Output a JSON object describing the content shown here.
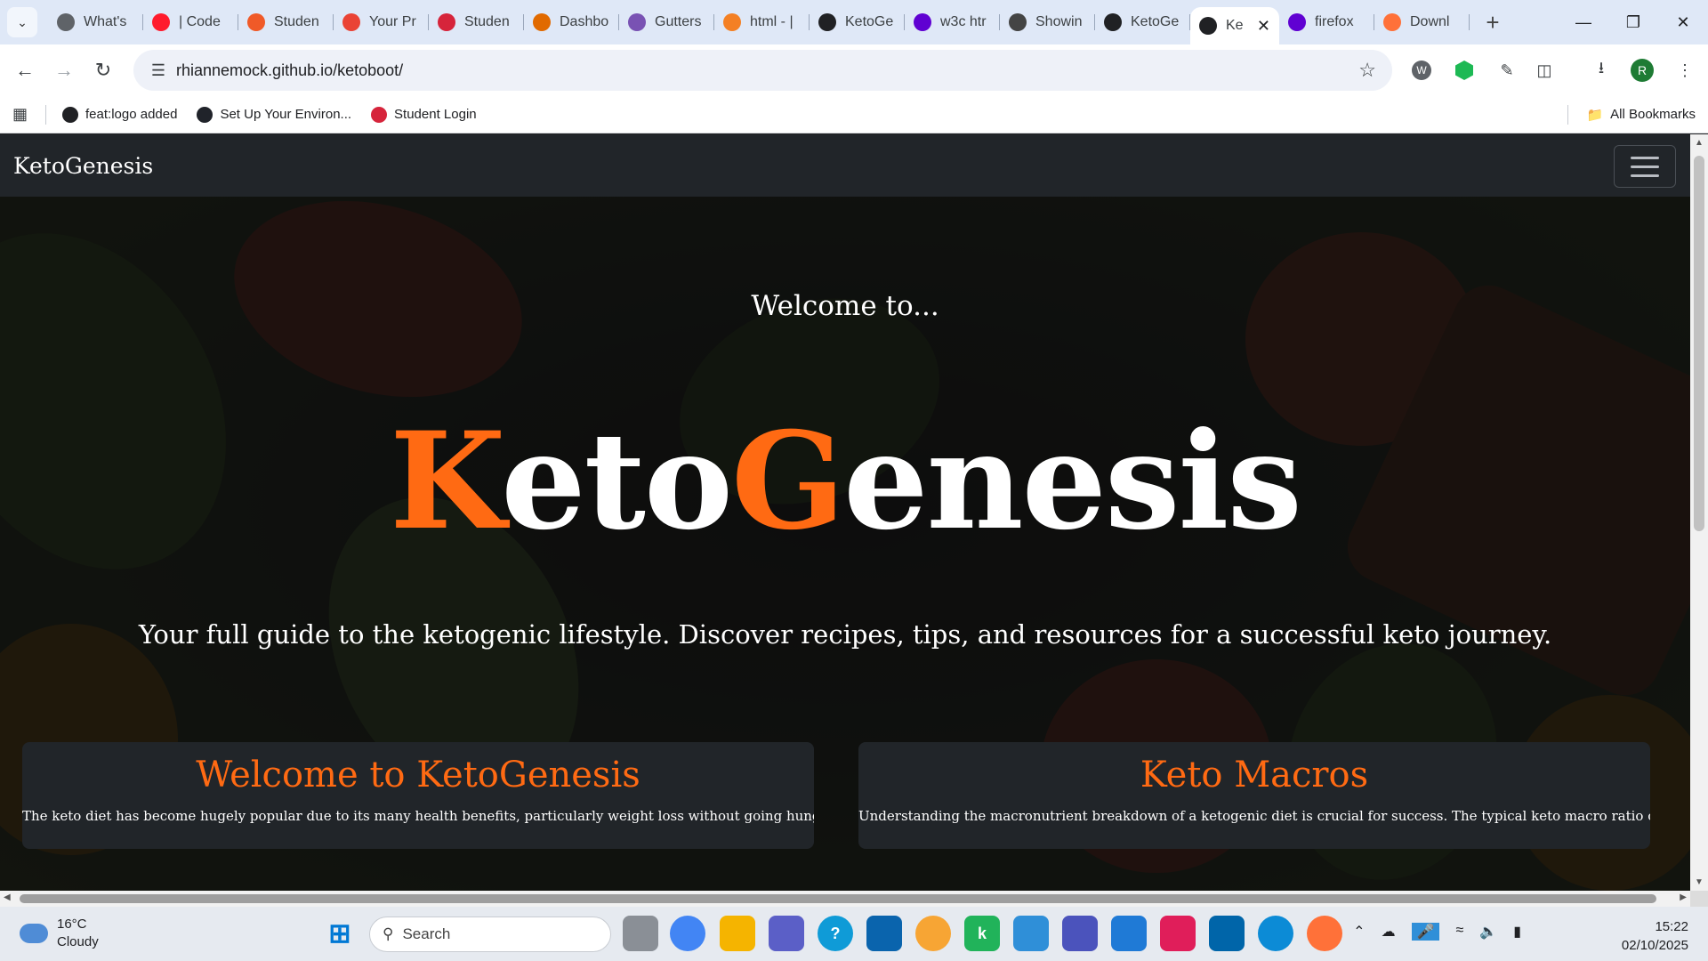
{
  "browser": {
    "tabs": [
      {
        "label": "What's",
        "icon": "chrome-icon",
        "color": "#5f6368"
      },
      {
        "label": "| Code",
        "icon": "opera-icon",
        "color": "#ff1b2d"
      },
      {
        "label": "Studen",
        "icon": "swirl-icon",
        "color": "#f05a28"
      },
      {
        "label": "Your Pr",
        "icon": "gmail-icon",
        "color": "#ea4335"
      },
      {
        "label": "Studen",
        "icon": "school-icon",
        "color": "#d6243b"
      },
      {
        "label": "Dashbo",
        "icon": "dashboard-icon",
        "color": "#e16a00"
      },
      {
        "label": "Gutters",
        "icon": "bootstrap-icon",
        "color": "#7952b3"
      },
      {
        "label": "html - |",
        "icon": "stackoverflow-icon",
        "color": "#f48024"
      },
      {
        "label": "KetoGe",
        "icon": "kg-icon",
        "color": "#202124"
      },
      {
        "label": "w3c htr",
        "icon": "yahoo-icon",
        "color": "#6001d2"
      },
      {
        "label": "Showin",
        "icon": "github-icon",
        "color": "#444444"
      },
      {
        "label": "KetoGe",
        "icon": "kg-icon",
        "color": "#202124"
      },
      {
        "label": "Ke",
        "icon": "kg-icon",
        "color": "#202124",
        "active": true
      },
      {
        "label": "firefox",
        "icon": "yahoo-icon",
        "color": "#6001d2"
      },
      {
        "label": "Downl",
        "icon": "firefox-icon",
        "color": "#ff7139"
      }
    ],
    "url": "rhiannemock.github.io/ketoboot/",
    "profile_initial": "R",
    "bookmarks": [
      {
        "label": "feat:logo added",
        "icon": "github-icon"
      },
      {
        "label": "Set Up Your Environ...",
        "icon": "react-icon"
      },
      {
        "label": "Student Login",
        "icon": "school-icon"
      }
    ],
    "all_bookmarks": "All Bookmarks"
  },
  "page": {
    "brand": "KetoGenesis",
    "hero": {
      "welcome": "Welcome to...",
      "title_k": "K",
      "title_eto": "eto",
      "title_g": "G",
      "title_enesis": "enesis",
      "tagline": "Your full guide to the ketogenic lifestyle. Discover recipes, tips, and resources for a successful keto journey."
    },
    "cards": [
      {
        "title": "Welcome to KetoGenesis",
        "text": "The keto diet has become hugely popular due to its many health benefits, particularly weight loss without going hungry."
      },
      {
        "title": "Keto Macros",
        "text": "Understanding the macronutrient breakdown of a ketogenic diet is crucial for success. The typical keto macro ratio consists of"
      }
    ],
    "accent_color": "#ff6a13"
  },
  "taskbar": {
    "weather_temp": "16°C",
    "weather_desc": "Cloudy",
    "search_label": "Search",
    "time": "15:22",
    "date": "02/10/2025"
  }
}
